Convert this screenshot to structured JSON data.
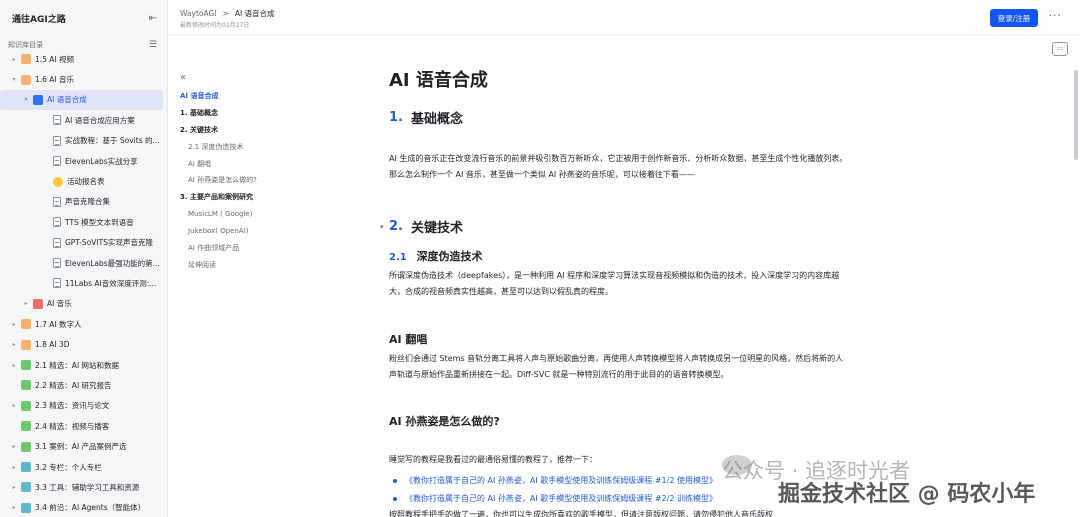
{
  "sidebar": {
    "title": "通往AGI之路",
    "section_label": "知识库目录",
    "items": [
      {
        "label": "1.5 AI 视频",
        "arrow": "▸",
        "icon": "folder",
        "color": "#f6b26b",
        "indent": 10
      },
      {
        "label": "1.6 AI 音乐",
        "arrow": "▾",
        "icon": "folder",
        "color": "#f6b26b",
        "indent": 10
      },
      {
        "label": "AI 语音合成",
        "arrow": "▾",
        "icon": "page",
        "color": "#3370ff",
        "indent": 22,
        "selected": true
      },
      {
        "label": "AI 语音合成应用方案",
        "arrow": "",
        "icon": "doc",
        "indent": 42
      },
      {
        "label": "实战教程：基于 Sovits 的...",
        "arrow": "",
        "icon": "doc",
        "indent": 42
      },
      {
        "label": "ElevenLabs实战分享",
        "arrow": "",
        "icon": "doc",
        "indent": 42
      },
      {
        "label": "活动报名表",
        "arrow": "",
        "icon": "dot",
        "indent": 42
      },
      {
        "label": "声音克隆合集",
        "arrow": "",
        "icon": "doc",
        "indent": 42
      },
      {
        "label": "TTS 模型文本到语音",
        "arrow": "",
        "icon": "doc",
        "indent": 42
      },
      {
        "label": "GPT-SoVITS实现声音克隆",
        "arrow": "",
        "icon": "doc",
        "indent": 42
      },
      {
        "label": "ElevenLabs最强功能的第...",
        "arrow": "",
        "icon": "doc",
        "indent": 42
      },
      {
        "label": "11Labs AI音效深度评测:...",
        "arrow": "",
        "icon": "doc",
        "indent": 42
      },
      {
        "label": "AI 音乐",
        "arrow": "▸",
        "icon": "page",
        "color": "#f76964",
        "indent": 22
      },
      {
        "label": "1.7 AI 数字人",
        "arrow": "▸",
        "icon": "folder",
        "color": "#f6b26b",
        "indent": 10
      },
      {
        "label": "1.8 AI 3D",
        "arrow": "▸",
        "icon": "folder",
        "color": "#f6b26b",
        "indent": 10
      },
      {
        "label": "2.1 精选：AI 网站和数据",
        "arrow": "▸",
        "icon": "folder",
        "color": "#6bc96b",
        "indent": 10
      },
      {
        "label": "2.2 精选：AI 研究报告",
        "arrow": "",
        "icon": "folder",
        "color": "#6bc96b",
        "indent": 10
      },
      {
        "label": "2.3 精选：资讯与论文",
        "arrow": "▸",
        "icon": "folder",
        "color": "#6bc96b",
        "indent": 10
      },
      {
        "label": "2.4 精选：视频与播客",
        "arrow": "",
        "icon": "folder",
        "color": "#6bc96b",
        "indent": 10
      },
      {
        "label": "3.1 案例：AI 产品案例严选",
        "arrow": "▸",
        "icon": "folder",
        "color": "#6bc96b",
        "indent": 10
      },
      {
        "label": "3.2 专栏：个人专栏",
        "arrow": "▸",
        "icon": "folder",
        "color": "#5fb8c9",
        "indent": 10
      },
      {
        "label": "3.3 工具：辅助学习工具和资源",
        "arrow": "▸",
        "icon": "folder",
        "color": "#5fb8c9",
        "indent": 10
      },
      {
        "label": "3.4 前沿：AI Agents（智能体）",
        "arrow": "▸",
        "icon": "folder",
        "color": "#5fb8c9",
        "indent": 10
      }
    ]
  },
  "header": {
    "crumb_root": "WaytoAGI",
    "crumb_sep": ">",
    "crumb_current": "AI 语音合成",
    "updated": "最新修改时间为02月27日",
    "login_label": "登录/注册",
    "more_label": "···"
  },
  "outline": {
    "items": [
      {
        "label": "AI 语音合成",
        "level": 1,
        "active": true
      },
      {
        "label": "1. 基础概念",
        "level": 1,
        "bold": true
      },
      {
        "label": "2. 关键技术",
        "level": 1,
        "bold": true
      },
      {
        "label": "2.1 深度伪造技术",
        "level": 2
      },
      {
        "label": "AI 翻唱",
        "level": 2
      },
      {
        "label": "AI 孙燕姿是怎么做的?",
        "level": 2
      },
      {
        "label": "3. 主要产品和案例研究",
        "level": 1,
        "bold": true
      },
      {
        "label": "MusicLM ( Google)",
        "level": 2
      },
      {
        "label": "Jukebox( OpenAI)",
        "level": 2
      },
      {
        "label": "AI 作曲领域产品",
        "level": 2
      },
      {
        "label": "延伸阅读",
        "level": 2
      }
    ]
  },
  "content": {
    "title": "AI 语音合成",
    "h1_basic_num": "1.",
    "h1_basic": "基础概念",
    "p_basic": "AI 生成的音乐正在改变流行音乐的前景并吸引数百万新听众，它正被用于创作新音乐、分析听众数据，甚至生成个性化播放列表。那么怎么制作一个 AI 音乐，甚至做一个类似 AI 孙燕姿的音乐呢，可以接着往下看——",
    "h1_key_num": "2.",
    "h1_key": "关键技术",
    "h2_deepfake_num": "2.1",
    "h2_deepfake": "深度伪造技术",
    "p_deepfake": "所谓深度伪造技术（deepfakes），是一种利用 AI 程序和深度学习算法实现音视频模拟和伪造的技术，投入深度学习的内容库越大，合成的视音频真实性越高，甚至可以达到以假乱真的程度。",
    "h3_cover": "AI 翻唱",
    "p_cover": "粉丝们会通过 Stems 音轨分离工具将人声与原始歌曲分离，再使用人声转换模型将人声转换成另一位明星的风格，然后将新的人声轨道与原始作品重新拼接在一起。Diff-SVC 就是一种特别流行的用于此目的的语音转换模型。",
    "h3_sun": "AI 孙燕姿是怎么做的?",
    "p_sun": "睡觉写的教程是我看过的最通俗易懂的教程了，推荐一下：",
    "link1": "《教你打造属于自己的 AI 孙燕姿，AI 歌手模型使用及训练保姆级课程 #1/2 使用模型》",
    "link2": "《教你打造属于自己的 AI 孙燕姿，AI 歌手模型使用及训练保姆级课程 #2/2 训练模型》",
    "p_partial": "按照教程手把手的做了一遍，你也可以生成你所喜欢的歌手模型，但请注意版权问题，请勿侵犯他人音乐版权"
  },
  "watermark": {
    "line1": "公众号 · 追逐时光者",
    "line2": "掘金技术社区 @ 码农小年"
  }
}
